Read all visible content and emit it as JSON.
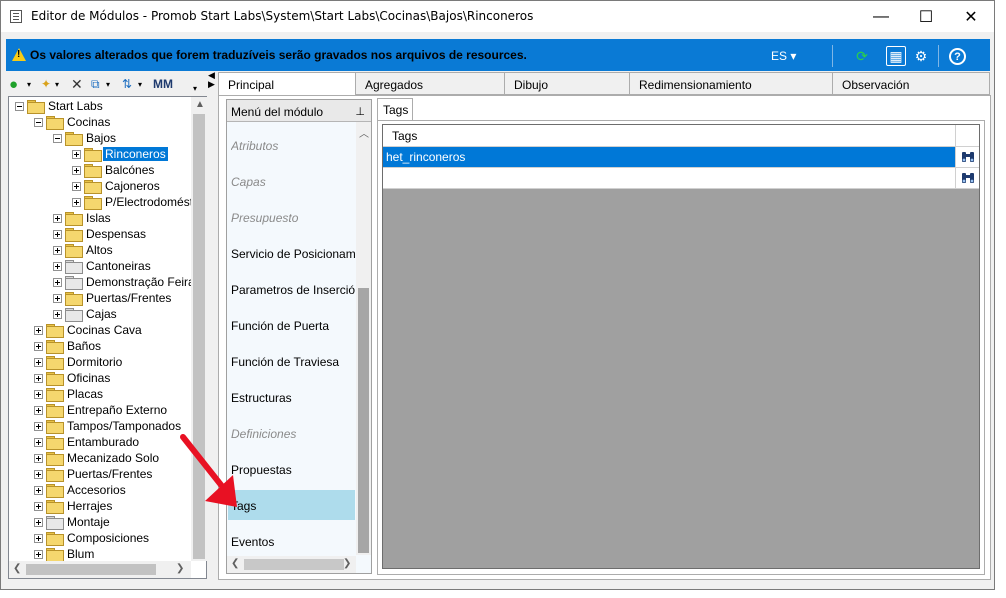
{
  "window": {
    "title": "Editor de Módulos - Promob Start Labs\\System\\Start Labs\\Cocinas\\Bajos\\Rinconeros",
    "minimize": "—",
    "maximize": "☐",
    "close": "✕"
  },
  "infobar": {
    "message": "Os valores alterados que forem traduzíveis serão gravados nos arquivos de resources.",
    "language": "ES ▾",
    "icons": {
      "refresh": "⟳",
      "panel": "▦",
      "settings": "⚙",
      "help": "?"
    }
  },
  "toolbar": {
    "back": "●",
    "new": "✦",
    "delete": "✕",
    "copy": "⧉",
    "sort": "⇅",
    "find": "🔍"
  },
  "tree": {
    "nodes": [
      {
        "label": "Start Labs",
        "level": 0,
        "expander": "minus",
        "folder": "yellow"
      },
      {
        "label": "Cocinas",
        "level": 1,
        "expander": "minus",
        "folder": "yellow"
      },
      {
        "label": "Bajos",
        "level": 2,
        "expander": "minus",
        "folder": "yellow"
      },
      {
        "label": "Rinconeros",
        "level": 3,
        "expander": "plus",
        "folder": "yellow",
        "selected": true
      },
      {
        "label": "Balcónes",
        "level": 3,
        "expander": "plus",
        "folder": "yellow"
      },
      {
        "label": "Cajoneros",
        "level": 3,
        "expander": "plus",
        "folder": "yellow"
      },
      {
        "label": "P/Electrodomést",
        "level": 3,
        "expander": "plus",
        "folder": "yellow"
      },
      {
        "label": "Islas",
        "level": 2,
        "expander": "plus",
        "folder": "yellow"
      },
      {
        "label": "Despensas",
        "level": 2,
        "expander": "plus",
        "folder": "yellow"
      },
      {
        "label": "Altos",
        "level": 2,
        "expander": "plus",
        "folder": "yellow"
      },
      {
        "label": "Cantoneiras",
        "level": 2,
        "expander": "plus",
        "folder": "grey"
      },
      {
        "label": "Demonstração Feira",
        "level": 2,
        "expander": "plus",
        "folder": "grey"
      },
      {
        "label": "Puertas/Frentes",
        "level": 2,
        "expander": "plus",
        "folder": "yellow"
      },
      {
        "label": "Cajas",
        "level": 2,
        "expander": "plus",
        "folder": "grey"
      },
      {
        "label": "Cocinas Cava",
        "level": 1,
        "expander": "plus",
        "folder": "yellow"
      },
      {
        "label": "Baños",
        "level": 1,
        "expander": "plus",
        "folder": "yellow"
      },
      {
        "label": "Dormitorio",
        "level": 1,
        "expander": "plus",
        "folder": "yellow"
      },
      {
        "label": "Oficinas",
        "level": 1,
        "expander": "plus",
        "folder": "yellow"
      },
      {
        "label": "Placas",
        "level": 1,
        "expander": "plus",
        "folder": "yellow"
      },
      {
        "label": "Entrepaño Externo",
        "level": 1,
        "expander": "plus",
        "folder": "yellow"
      },
      {
        "label": "Tampos/Tamponados",
        "level": 1,
        "expander": "plus",
        "folder": "yellow"
      },
      {
        "label": "Entamburado",
        "level": 1,
        "expander": "plus",
        "folder": "yellow"
      },
      {
        "label": "Mecanizado Solo",
        "level": 1,
        "expander": "plus",
        "folder": "yellow"
      },
      {
        "label": "Puertas/Frentes",
        "level": 1,
        "expander": "plus",
        "folder": "yellow"
      },
      {
        "label": "Accesorios",
        "level": 1,
        "expander": "plus",
        "folder": "yellow"
      },
      {
        "label": "Herrajes",
        "level": 1,
        "expander": "plus",
        "folder": "yellow"
      },
      {
        "label": "Montaje",
        "level": 1,
        "expander": "plus",
        "folder": "grey"
      },
      {
        "label": "Composiciones",
        "level": 1,
        "expander": "plus",
        "folder": "yellow"
      },
      {
        "label": "Blum",
        "level": 1,
        "expander": "plus",
        "folder": "yellow"
      }
    ]
  },
  "tabs": [
    "Principal",
    "Agregados",
    "Dibujo",
    "Redimensionamiento",
    "Observación"
  ],
  "module_menu": {
    "header": "Menú del módulo",
    "pin": "⊥",
    "items": [
      {
        "label": "Atributos",
        "disabled": true
      },
      {
        "label": "Capas",
        "disabled": true
      },
      {
        "label": "Presupuesto",
        "disabled": true
      },
      {
        "label": "Servicio de Posicionamiento",
        "disabled": false
      },
      {
        "label": "Parametros de Inserción",
        "disabled": false
      },
      {
        "label": "Función de Puerta",
        "disabled": false
      },
      {
        "label": "Función de Traviesa",
        "disabled": false
      },
      {
        "label": "Estructuras",
        "disabled": false
      },
      {
        "label": "Definiciones",
        "disabled": true
      },
      {
        "label": "Propuestas",
        "disabled": false
      },
      {
        "label": "Tags",
        "disabled": false,
        "selected": true
      },
      {
        "label": "Eventos",
        "disabled": false
      }
    ]
  },
  "tags_panel": {
    "tab_label": "Tags",
    "column_header": "Tags",
    "rows": [
      {
        "value": "het_rinconeros",
        "selected": true
      },
      {
        "value": "",
        "selected": false
      }
    ],
    "find_icon": "👓"
  },
  "colors": {
    "accent": "#0a7ad5",
    "selection": "#0078d7",
    "menu_selection": "#aedcec",
    "arrow": "#e81123"
  }
}
